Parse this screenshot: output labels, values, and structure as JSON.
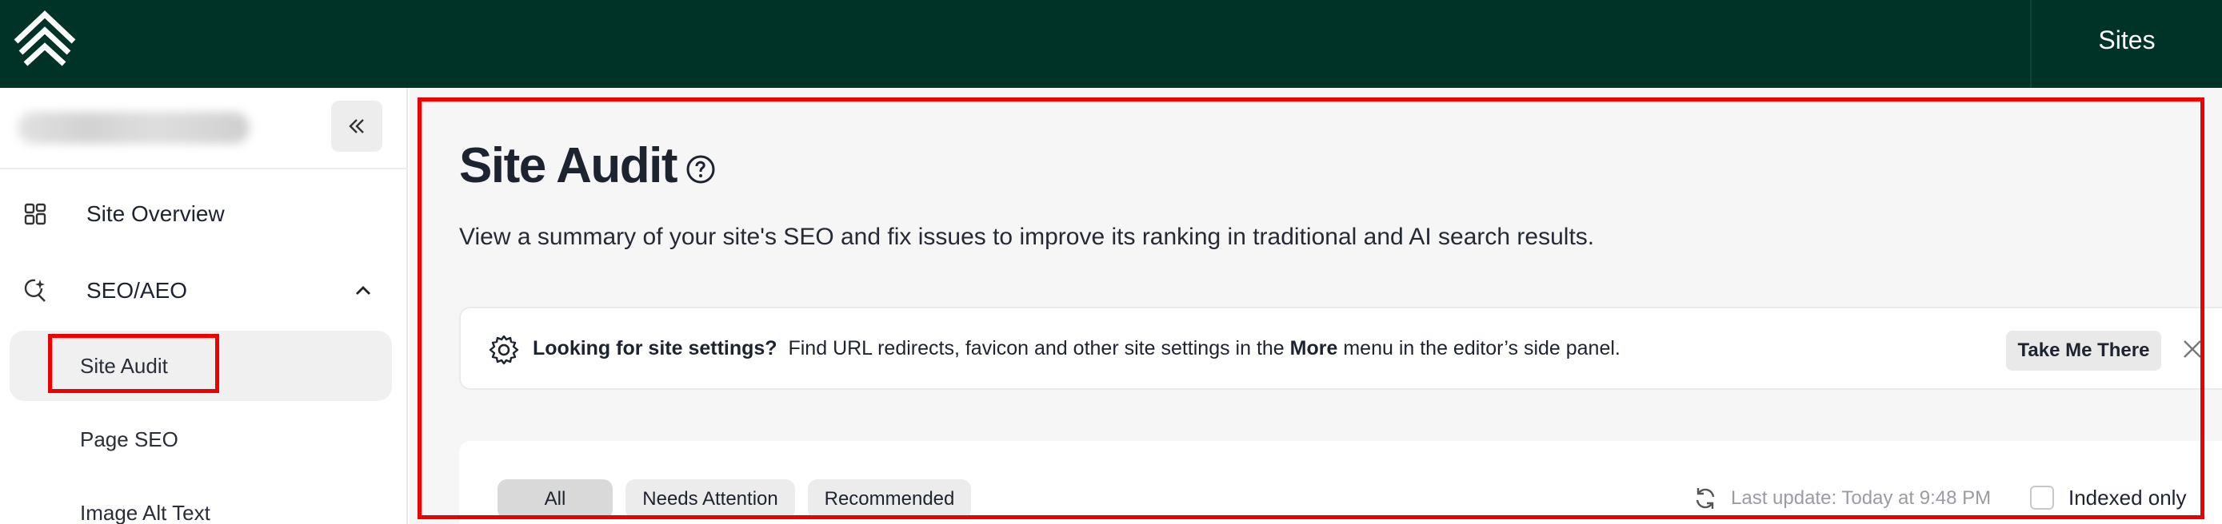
{
  "topbar": {
    "sites_label": "Sites"
  },
  "sidebar": {
    "items": [
      {
        "label": "Site Overview",
        "icon": "grid-icon"
      },
      {
        "label": "SEO/AEO",
        "icon": "search-sparkle-icon",
        "expanded": true
      }
    ],
    "subitems": [
      {
        "label": "Site Audit",
        "active": true
      },
      {
        "label": "Page SEO"
      },
      {
        "label": "Image Alt Text"
      }
    ]
  },
  "main": {
    "title": "Site Audit",
    "subtitle": "View a summary of your site's SEO and fix issues to improve its ranking in traditional and AI search results.",
    "banner": {
      "heading": "Looking for site settings?",
      "text_before": "Find URL redirects, favicon and other site settings in the",
      "text_bold": "More",
      "text_after": "menu in the editor’s side panel.",
      "button_label": "Take Me There"
    },
    "filters": [
      {
        "label": "All",
        "active": true
      },
      {
        "label": "Needs Attention"
      },
      {
        "label": "Recommended"
      }
    ],
    "last_update": "Last update: Today at 9:48 PM",
    "indexed_only_label": "Indexed only"
  },
  "colors": {
    "topbar": "#003327",
    "highlight": "#ee0000"
  }
}
